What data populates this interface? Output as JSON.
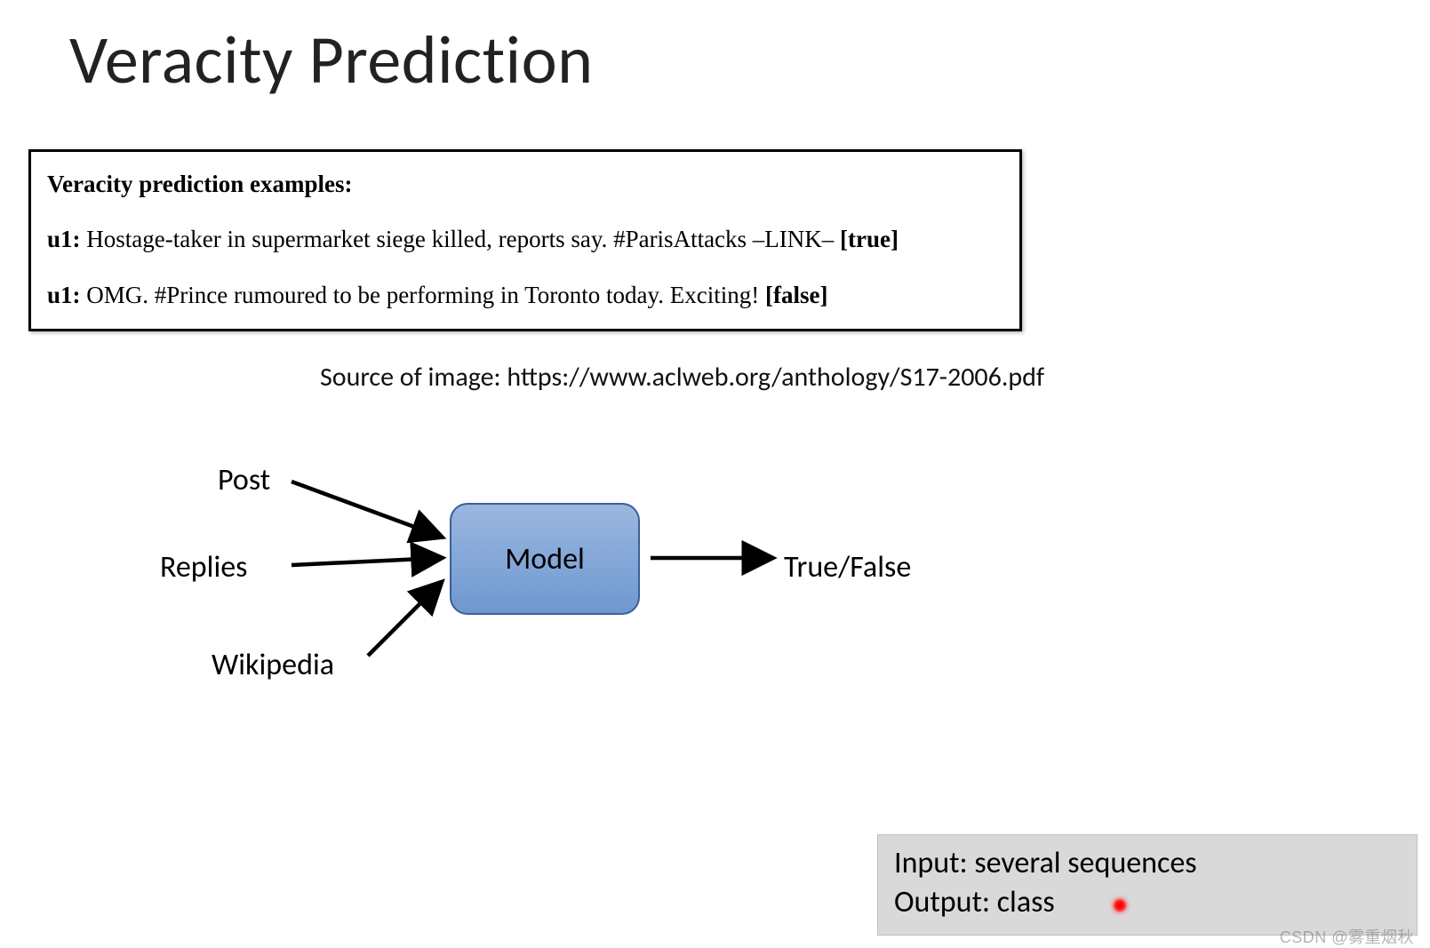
{
  "title": "Veracity Prediction",
  "examples": {
    "heading": "Veracity prediction examples:",
    "rows": [
      {
        "tag": "u1:",
        "text": " Hostage-taker in supermarket siege killed, reports say. #ParisAttacks –LINK– ",
        "flag": "[true]"
      },
      {
        "tag": "u1:",
        "text": " OMG. #Prince rumoured to be performing in Toronto today. Exciting! ",
        "flag": "[false]"
      }
    ]
  },
  "source_line": "Source of image: https://www.aclweb.org/anthology/S17-2006.pdf",
  "diagram": {
    "inputs": {
      "post": "Post",
      "replies": "Replies",
      "wikipedia": "Wikipedia"
    },
    "model": "Model",
    "output": "True/False"
  },
  "footer": {
    "line1": "Input: several sequences",
    "line2": "Output: class"
  },
  "watermark": "CSDN @雾重烟秋"
}
